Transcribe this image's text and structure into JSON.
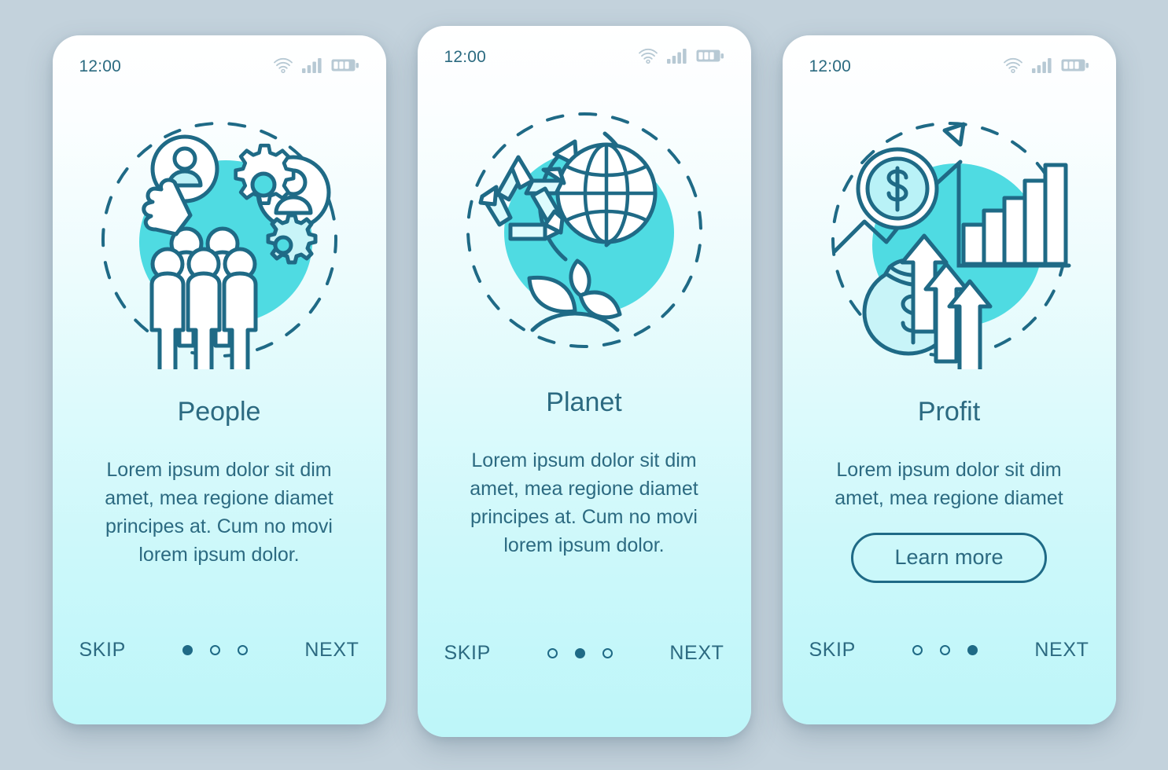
{
  "theme": {
    "page_background": "#c3d2dc",
    "card_top": "#ffffff",
    "card_bottom": "#bdf6f9",
    "accent_teal": "#4fdbe2",
    "outline_dark": "#1f6a86",
    "text_color": "#2c6a81",
    "status_icon_color": "#b7c9d4"
  },
  "screens": [
    {
      "id": "people",
      "status": {
        "time": "12:00",
        "wifi_icon": "wifi-icon",
        "signal_icon": "signal-bars-icon",
        "battery_icon": "battery-icon"
      },
      "illustration_name": "people-teamwork-illustration",
      "illustration_parts": [
        "hand-pointer-icon",
        "user-avatar-circle-icon",
        "gear-icon",
        "small-gear-icon",
        "user-profile-circle-icon",
        "crowd-of-people-icon",
        "teal-blob-background",
        "dashed-circle-outline"
      ],
      "title": "People",
      "description": "Lorem ipsum dolor sit dim\namet, mea regione diamet\nprincipes at. Cum no movi\nlorem ipsum dolor.",
      "has_learn_more": false,
      "learn_more_label": "",
      "skip_label": "SKIP",
      "next_label": "NEXT",
      "dots": [
        true,
        false,
        false
      ]
    },
    {
      "id": "planet",
      "status": {
        "time": "12:00",
        "wifi_icon": "wifi-icon",
        "signal_icon": "signal-bars-icon",
        "battery_icon": "battery-icon"
      },
      "illustration_name": "planet-sustainability-illustration",
      "illustration_parts": [
        "recycle-symbol-icon",
        "globe-icon",
        "rotating-arrows-icon",
        "leaves-sprout-icon",
        "teal-blob-background",
        "dashed-circle-outline"
      ],
      "title": "Planet",
      "description": "Lorem ipsum dolor sit dim\namet, mea regione diamet\nprincipes at. Cum no movi\nlorem ipsum dolor.",
      "has_learn_more": false,
      "learn_more_label": "",
      "skip_label": "SKIP",
      "next_label": "NEXT",
      "dots": [
        false,
        true,
        false
      ]
    },
    {
      "id": "profit",
      "status": {
        "time": "12:00",
        "wifi_icon": "wifi-icon",
        "signal_icon": "signal-bars-icon",
        "battery_icon": "battery-icon"
      },
      "illustration_name": "profit-growth-illustration",
      "illustration_parts": [
        "dollar-coin-magnifier-icon",
        "growth-arrow-icon",
        "bar-chart-icon",
        "money-bag-icon",
        "up-arrows-icon",
        "teal-blob-background",
        "dashed-circle-outline"
      ],
      "title": "Profit",
      "description": "Lorem ipsum dolor sit dim\namet, mea regione diamet",
      "has_learn_more": true,
      "learn_more_label": "Learn more",
      "skip_label": "SKIP",
      "next_label": "NEXT",
      "dots": [
        false,
        false,
        true
      ]
    }
  ]
}
